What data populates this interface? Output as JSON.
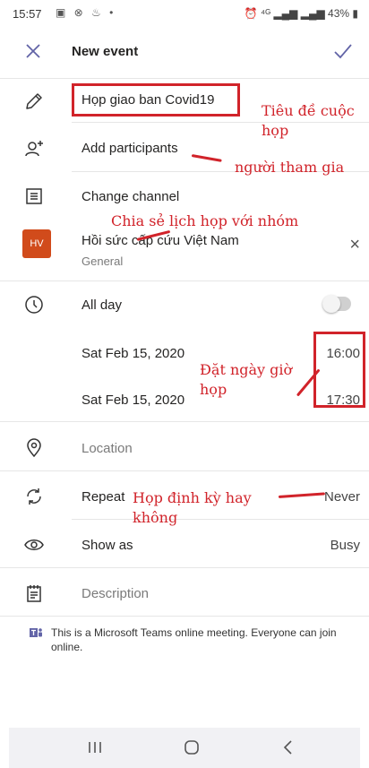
{
  "status": {
    "time": "15:57",
    "icons": "▣ ⊗ ♨ •",
    "right": "⏰ ⁴ᴳ ▂▄▆ ▂▄▆ 43% ▮"
  },
  "header": {
    "title": "New event"
  },
  "fields": {
    "title": "Họp giao ban Covid19",
    "participants": "Add participants",
    "channel": "Change channel",
    "team_avatar": "HV",
    "team_name": "Hồi sức cấp cứu Việt Nam",
    "team_channel": "General",
    "team_remove": "×",
    "all_day": "All day",
    "start_date": "Sat Feb 15, 2020",
    "start_time": "16:00",
    "end_date": "Sat Feb 15, 2020",
    "end_time": "17:30",
    "location_placeholder": "Location",
    "repeat": "Repeat",
    "repeat_value": "Never",
    "show_as": "Show as",
    "show_as_value": "Busy",
    "description_placeholder": "Description"
  },
  "note": "This is a Microsoft Teams online meeting. Everyone can join online.",
  "annotations": {
    "title": "Tiêu đề cuộc họp",
    "participants": "người tham gia",
    "channel": "Chia sẻ lịch họp với nhóm",
    "datetime": "Đặt ngày giờ họp",
    "repeat": "Họp định kỳ hay không"
  },
  "colors": {
    "accent": "#6264a7",
    "annotation": "#d1232a",
    "team_avatar": "#d14b1b"
  },
  "icons": [
    "close-icon",
    "check-icon",
    "pencil-icon",
    "add-person-icon",
    "channel-list-icon",
    "clock-icon",
    "location-pin-icon",
    "repeat-icon",
    "eye-icon",
    "notepad-icon",
    "teams-icon",
    "recents-icon",
    "home-icon",
    "back-icon"
  ]
}
